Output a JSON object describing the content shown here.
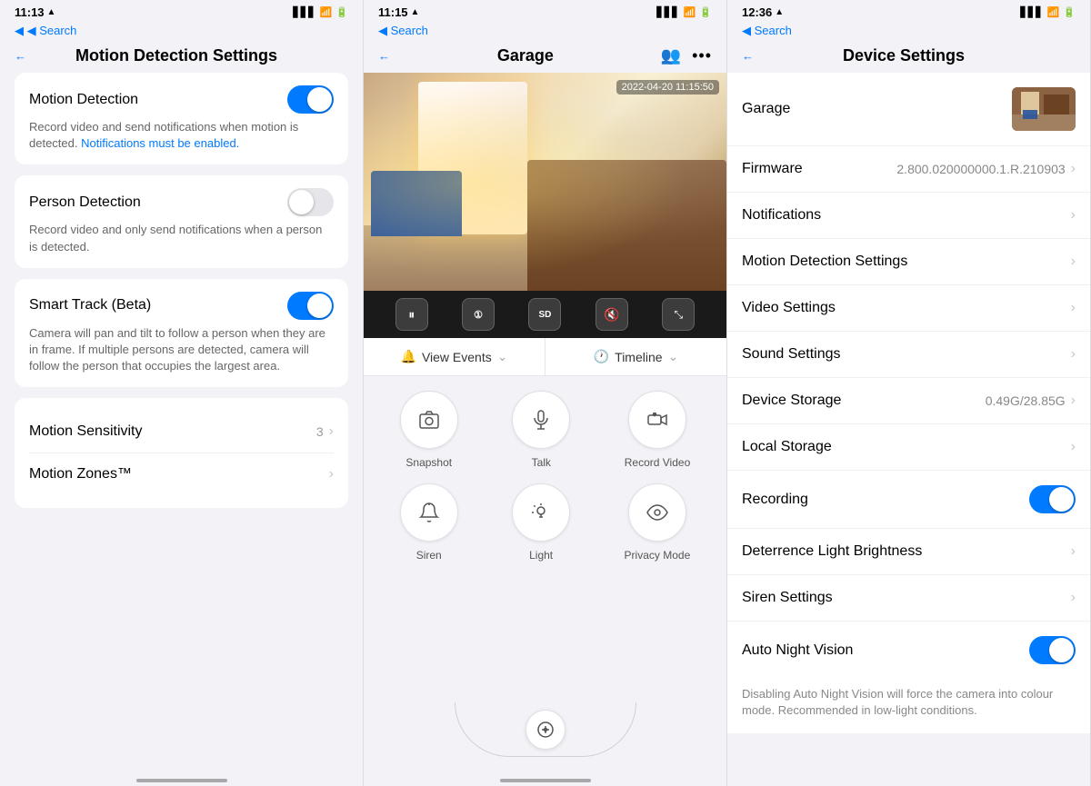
{
  "panel1": {
    "statusBar": {
      "time": "11:13",
      "locationIcon": "▲",
      "searchBack": "◀ Search",
      "signalBars": "▋▋▋",
      "wifi": "WiFi",
      "battery": "🔋"
    },
    "nav": {
      "backIcon": "←",
      "title": "Motion Detection Settings"
    },
    "settings": [
      {
        "id": "motion-detection",
        "label": "Motion Detection",
        "toggle": true,
        "toggleState": "on",
        "desc": "Record video and send notifications when motion is detected.",
        "link": "Notifications must be enabled."
      },
      {
        "id": "person-detection",
        "label": "Person Detection",
        "toggle": true,
        "toggleState": "off",
        "desc": "Record video and only send notifications when a person is detected."
      },
      {
        "id": "smart-track",
        "label": "Smart Track (Beta)",
        "toggle": true,
        "toggleState": "on",
        "desc": "Camera will pan and tilt to follow a person when they are in frame. If multiple persons are detected, camera will follow the person that occupies the largest area."
      }
    ],
    "listItems": [
      {
        "label": "Motion Sensitivity",
        "value": "3",
        "hasArrow": true
      },
      {
        "label": "Motion Zones™",
        "value": "",
        "hasArrow": true
      }
    ]
  },
  "panel2": {
    "statusBar": {
      "time": "11:15",
      "locationIcon": "▲"
    },
    "nav": {
      "backIcon": "←",
      "title": "Garage",
      "peopleIcon": "👥",
      "moreIcon": "···"
    },
    "cameraTimestamp": "2022-04-20 11:15:50",
    "controls": [
      {
        "id": "pause",
        "icon": "⏸",
        "label": "Pause"
      },
      {
        "id": "channel",
        "icon": "①",
        "label": "Channel 1"
      },
      {
        "id": "sd",
        "icon": "SD",
        "label": "SD Quality"
      },
      {
        "id": "mute",
        "icon": "🔇",
        "label": "Mute"
      },
      {
        "id": "fullscreen",
        "icon": "⛶",
        "label": "Fullscreen"
      }
    ],
    "eventsBar": [
      {
        "id": "view-events",
        "icon": "🔔",
        "label": "View Events",
        "hasChevron": true
      },
      {
        "id": "timeline",
        "icon": "🕐",
        "label": "Timeline",
        "hasChevron": true
      }
    ],
    "actions": [
      [
        {
          "id": "snapshot",
          "icon": "📷",
          "label": "Snapshot"
        },
        {
          "id": "talk",
          "icon": "🎙",
          "label": "Talk"
        },
        {
          "id": "record-video",
          "icon": "📹",
          "label": "Record Video"
        }
      ],
      [
        {
          "id": "siren",
          "icon": "🔔",
          "label": "Siren"
        },
        {
          "id": "light",
          "icon": "💡",
          "label": "Light"
        },
        {
          "id": "privacy-mode",
          "icon": "👁",
          "label": "Privacy Mode"
        }
      ]
    ],
    "panControl": {
      "icon": "⊕",
      "label": "Pan Control"
    }
  },
  "panel3": {
    "statusBar": {
      "time": "12:36",
      "locationIcon": "▲"
    },
    "nav": {
      "backIcon": "←",
      "title": "Device Settings"
    },
    "device": {
      "name": "Garage",
      "thumbAlt": "Garage Camera"
    },
    "listItems": [
      {
        "id": "firmware",
        "label": "Firmware",
        "value": "2.800.020000000.1.R.210903",
        "hasArrow": true,
        "toggle": false
      },
      {
        "id": "notifications",
        "label": "Notifications",
        "value": "",
        "hasArrow": true,
        "toggle": false
      },
      {
        "id": "motion-detection-settings",
        "label": "Motion Detection Settings",
        "value": "",
        "hasArrow": true,
        "toggle": false
      },
      {
        "id": "video-settings",
        "label": "Video Settings",
        "value": "",
        "hasArrow": true,
        "toggle": false
      },
      {
        "id": "sound-settings",
        "label": "Sound Settings",
        "value": "",
        "hasArrow": true,
        "toggle": false
      },
      {
        "id": "device-storage",
        "label": "Device Storage",
        "value": "0.49G/28.85G",
        "hasArrow": true,
        "toggle": false
      },
      {
        "id": "local-storage",
        "label": "Local Storage",
        "value": "",
        "hasArrow": true,
        "toggle": false
      },
      {
        "id": "recording",
        "label": "Recording",
        "value": "",
        "hasArrow": false,
        "toggle": true,
        "toggleState": "on"
      },
      {
        "id": "deterrence-light",
        "label": "Deterrence Light Brightness",
        "value": "",
        "hasArrow": true,
        "toggle": false
      },
      {
        "id": "siren-settings",
        "label": "Siren Settings",
        "value": "",
        "hasArrow": true,
        "toggle": false
      },
      {
        "id": "auto-night-vision",
        "label": "Auto Night Vision",
        "value": "",
        "hasArrow": false,
        "toggle": true,
        "toggleState": "on"
      }
    ],
    "nightVisionNote": "Disabling Auto Night Vision will force the camera into colour mode. Recommended in low-light conditions."
  },
  "icons": {
    "back": "←",
    "chevron": "›",
    "location": "▲",
    "people": "👥",
    "more": "•••"
  }
}
